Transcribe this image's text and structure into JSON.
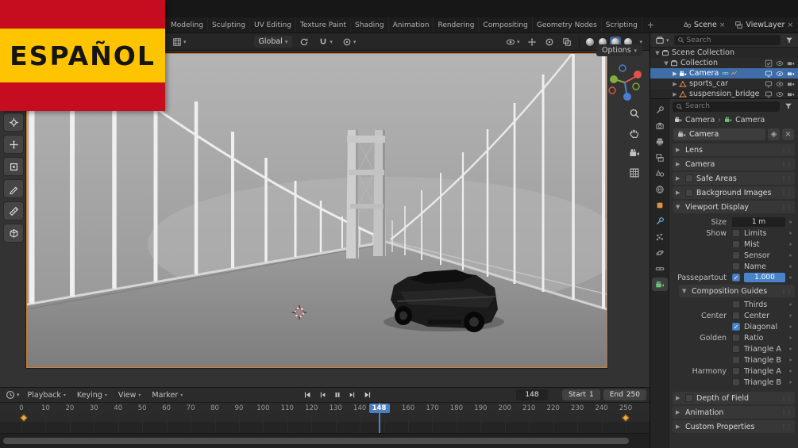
{
  "overlay": {
    "flag_label": "ESPAÑOL"
  },
  "topbar": {
    "tabs": [
      "Modeling",
      "Sculpting",
      "UV Editing",
      "Texture Paint",
      "Shading",
      "Animation",
      "Rendering",
      "Compositing",
      "Geometry Nodes",
      "Scripting"
    ],
    "add_workspace": "+",
    "scene_name": "Scene",
    "view_layer_name": "ViewLayer"
  },
  "viewport": {
    "header": {
      "transform_orientation": "Global",
      "options_label": "Options"
    },
    "toolbar_tools": [
      "cursor-tool",
      "move-tool",
      "transform-tool",
      "annotate-tool",
      "measure-tool",
      "add-cube-tool"
    ],
    "nav_icons": [
      "zoom-icon",
      "pan-hand-icon",
      "camera-view-icon",
      "grid-ortho-icon"
    ],
    "shading_modes": [
      "wireframe",
      "solid",
      "material-preview",
      "rendered"
    ],
    "active_shading": "material-preview"
  },
  "outliner": {
    "search_placeholder": "Search",
    "items": [
      {
        "label": "Scene Collection",
        "level": 0,
        "icon": "scene-collection",
        "expand": "open",
        "selected": false,
        "badges": [],
        "right": []
      },
      {
        "label": "Collection",
        "level": 1,
        "icon": "collection",
        "expand": "open",
        "selected": false,
        "badges": [],
        "right": [
          "checkbox",
          "eye",
          "camera"
        ]
      },
      {
        "label": "Camera",
        "level": 2,
        "icon": "camera",
        "expand": "closed",
        "selected": true,
        "badges": [
          "constraint",
          "animation"
        ],
        "right": [
          "screen",
          "eye",
          "camera"
        ]
      },
      {
        "label": "sports_car",
        "level": 2,
        "icon": "mesh",
        "expand": "closed",
        "selected": false,
        "badges": [],
        "right": [
          "screen",
          "eye",
          "camera"
        ]
      },
      {
        "label": "suspension_bridge",
        "level": 2,
        "icon": "mesh",
        "expand": "closed",
        "selected": false,
        "badges": [],
        "right": [
          "screen",
          "eye",
          "camera"
        ]
      }
    ]
  },
  "properties": {
    "search_placeholder": "Search",
    "tabs": [
      "tool",
      "render",
      "output",
      "view-layer",
      "scene",
      "world",
      "object",
      "modifiers",
      "particles",
      "physics",
      "constraints",
      "object-data"
    ],
    "active_tab": "object-data",
    "breadcrumb": {
      "object": "Camera",
      "data": "Camera"
    },
    "id_name": "Camera",
    "sections_top": [
      {
        "label": "Lens",
        "checkbox": false
      },
      {
        "label": "Camera",
        "checkbox": false
      },
      {
        "label": "Safe Areas",
        "checkbox": true
      },
      {
        "label": "Background Images",
        "checkbox": true
      }
    ],
    "viewport_display": {
      "title": "Viewport Display",
      "size_label": "Size",
      "size_value": "1 m",
      "show_rows": [
        {
          "label": "Show",
          "toggle": "Limits",
          "checked": false
        },
        {
          "label": "",
          "toggle": "Mist",
          "checked": false
        },
        {
          "label": "",
          "toggle": "Sensor",
          "checked": false
        },
        {
          "label": "",
          "toggle": "Name",
          "checked": false
        }
      ],
      "passepartout_label": "Passepartout",
      "passepartout_checked": true,
      "passepartout_value": "1.000",
      "guides": {
        "title": "Composition Guides",
        "rows": [
          {
            "label": "",
            "toggle": "Thirds",
            "checked": false
          },
          {
            "label": "Center",
            "toggle": "Center",
            "checked": false
          },
          {
            "label": "",
            "toggle": "Diagonal",
            "checked": true
          },
          {
            "label": "Golden",
            "toggle": "Ratio",
            "checked": false
          },
          {
            "label": "",
            "toggle": "Triangle A",
            "checked": false
          },
          {
            "label": "",
            "toggle": "Triangle B",
            "checked": false
          },
          {
            "label": "Harmony",
            "toggle": "Triangle A",
            "checked": false
          },
          {
            "label": "",
            "toggle": "Triangle B",
            "checked": false
          }
        ]
      }
    },
    "sections_bottom": [
      {
        "label": "Depth of Field",
        "checkbox": true
      },
      {
        "label": "Animation",
        "checkbox": false
      },
      {
        "label": "Custom Properties",
        "checkbox": false
      }
    ]
  },
  "timeline": {
    "menus": [
      "Playback",
      "Keying",
      "View",
      "Marker"
    ],
    "transport": [
      "jump-start",
      "prev-keyframe",
      "pause",
      "next-keyframe",
      "jump-end"
    ],
    "current_frame": "148",
    "start_label": "Start",
    "start_value": "1",
    "end_label": "End",
    "end_value": "250",
    "tick_min": 0,
    "tick_max": 250,
    "tick_step": 10,
    "playhead_frame": 148,
    "keyframe_frames": [
      1,
      250
    ]
  },
  "colors": {
    "accent_blue": "#5680c2",
    "selection_blue": "#3f6da8",
    "object_orange": "#e08f44",
    "keyframe_orange": "#eea93c",
    "camera_border_orange": "#cf7c33",
    "flag_red": "#c50d1f",
    "flag_yellow": "#ffc400"
  }
}
